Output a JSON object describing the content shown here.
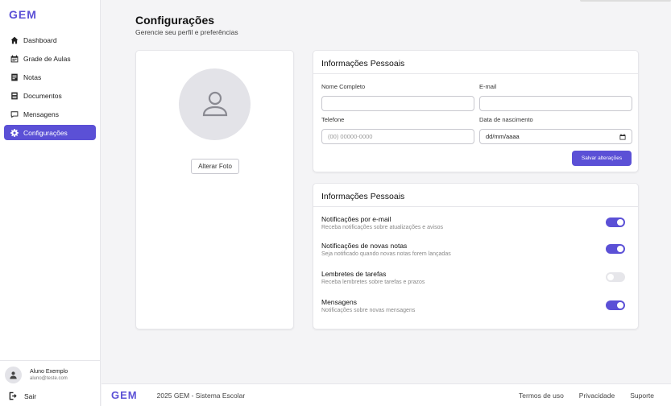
{
  "app": {
    "logo": "GEM"
  },
  "sidebar": {
    "items": [
      {
        "label": "Dashboard",
        "icon": "home-icon"
      },
      {
        "label": "Grade de Aulas",
        "icon": "calendar-icon"
      },
      {
        "label": "Notas",
        "icon": "notes-icon"
      },
      {
        "label": "Documentos",
        "icon": "document-icon"
      },
      {
        "label": "Mensagens",
        "icon": "message-icon"
      },
      {
        "label": "Configurações",
        "icon": "gear-icon",
        "active": true
      }
    ],
    "user": {
      "name": "Aluno Exemplo",
      "email": "aluno@teste.com"
    },
    "logout_label": "Sair"
  },
  "header": {
    "title": "Configurações",
    "subtitle": "Gerencie seu perfil e preferências"
  },
  "photo": {
    "button_label": "Alterar Foto"
  },
  "personal": {
    "title": "Informações Pessoais",
    "name_label": "Nome Completo",
    "name_value": "",
    "email_label": "E-mail",
    "email_value": "",
    "phone_label": "Telefone",
    "phone_placeholder": "(00) 00000-0000",
    "birth_label": "Data de nascimento",
    "birth_placeholder": "dd/mm/aaaa",
    "save_label": "Salvar alterações"
  },
  "notifications": {
    "title": "Informações Pessoais",
    "items": [
      {
        "title": "Notificações por e-mail",
        "desc": "Receba notificações sobre atualizações e avisos",
        "enabled": true
      },
      {
        "title": "Notificações  de novas notas",
        "desc": "Seja notificado quando novas notas forem lançadas",
        "enabled": true
      },
      {
        "title": "Lembretes de tarefas",
        "desc": "Receba lembretes sobre tarefas e prazos",
        "enabled": false
      },
      {
        "title": "Mensagens",
        "desc": "Notificações sobre novas mensagens",
        "enabled": true
      }
    ]
  },
  "footer": {
    "logo": "GEM",
    "copyright": "2025 GEM - Sistema Escolar",
    "links": [
      "Termos de uso",
      "Privacidade",
      "Suporte"
    ]
  },
  "colors": {
    "accent": "#5b50d6",
    "background": "#f4f4f6",
    "toggle_off": "#e6e6ea"
  }
}
